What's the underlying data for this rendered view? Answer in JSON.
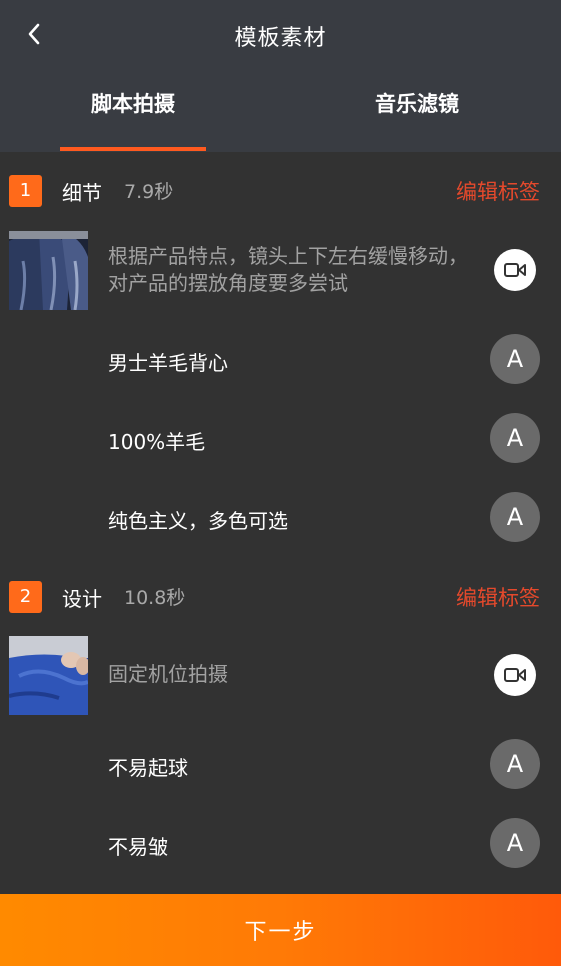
{
  "header": {
    "title": "模板素材",
    "back_icon": "chevron-left-icon"
  },
  "tabs": [
    {
      "label": "脚本拍摄",
      "active": true
    },
    {
      "label": "音乐滤镜",
      "active": false
    }
  ],
  "colors": {
    "accent": "#ff6a1a",
    "edit_tag": "#e4492c",
    "header_bg": "#393c42",
    "body_bg": "#323232"
  },
  "sections": [
    {
      "number": "1",
      "name": "细节",
      "duration": "7.9秒",
      "edit_label": "编辑标签",
      "description": "根据产品特点，镜头上下左右缓慢移动，对产品的摆放角度要多尝试",
      "video_icon": "video-camera-icon",
      "captions": [
        "男士羊毛背心",
        "100%羊毛",
        "纯色主义，多色可选"
      ]
    },
    {
      "number": "2",
      "name": "设计",
      "duration": "10.8秒",
      "edit_label": "编辑标签",
      "description": "固定机位拍摄",
      "video_icon": "video-camera-icon",
      "captions": [
        "不易起球",
        "不易皱"
      ]
    }
  ],
  "caption_button_label": "A",
  "next_button": "下一步"
}
